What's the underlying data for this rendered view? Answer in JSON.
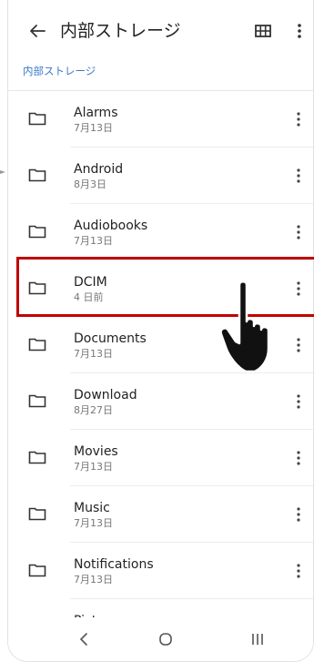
{
  "appbar": {
    "title": "内部ストレージ",
    "back_icon": "arrow-back-icon",
    "grid_icon": "grid-view-icon",
    "more_icon": "more-vert-icon"
  },
  "breadcrumb": "内部ストレージ",
  "folders": [
    {
      "name": "Alarms",
      "date": "7月13日"
    },
    {
      "name": "Android",
      "date": "8月3日"
    },
    {
      "name": "Audiobooks",
      "date": "7月13日"
    },
    {
      "name": "DCIM",
      "date": "4 日前"
    },
    {
      "name": "Documents",
      "date": "7月13日"
    },
    {
      "name": "Download",
      "date": "8月27日"
    },
    {
      "name": "Movies",
      "date": "7月13日"
    },
    {
      "name": "Music",
      "date": "7月13日"
    },
    {
      "name": "Notifications",
      "date": "7月13日"
    },
    {
      "name": "Pictures",
      "date": ""
    }
  ],
  "highlighted_folder": "DCIM",
  "navbar": {
    "back_icon": "nav-back-icon",
    "home_icon": "nav-home-icon",
    "recents_icon": "nav-recents-icon"
  },
  "colors": {
    "accent": "#3a78c8",
    "highlight": "#c00000",
    "icon": "#333333"
  }
}
